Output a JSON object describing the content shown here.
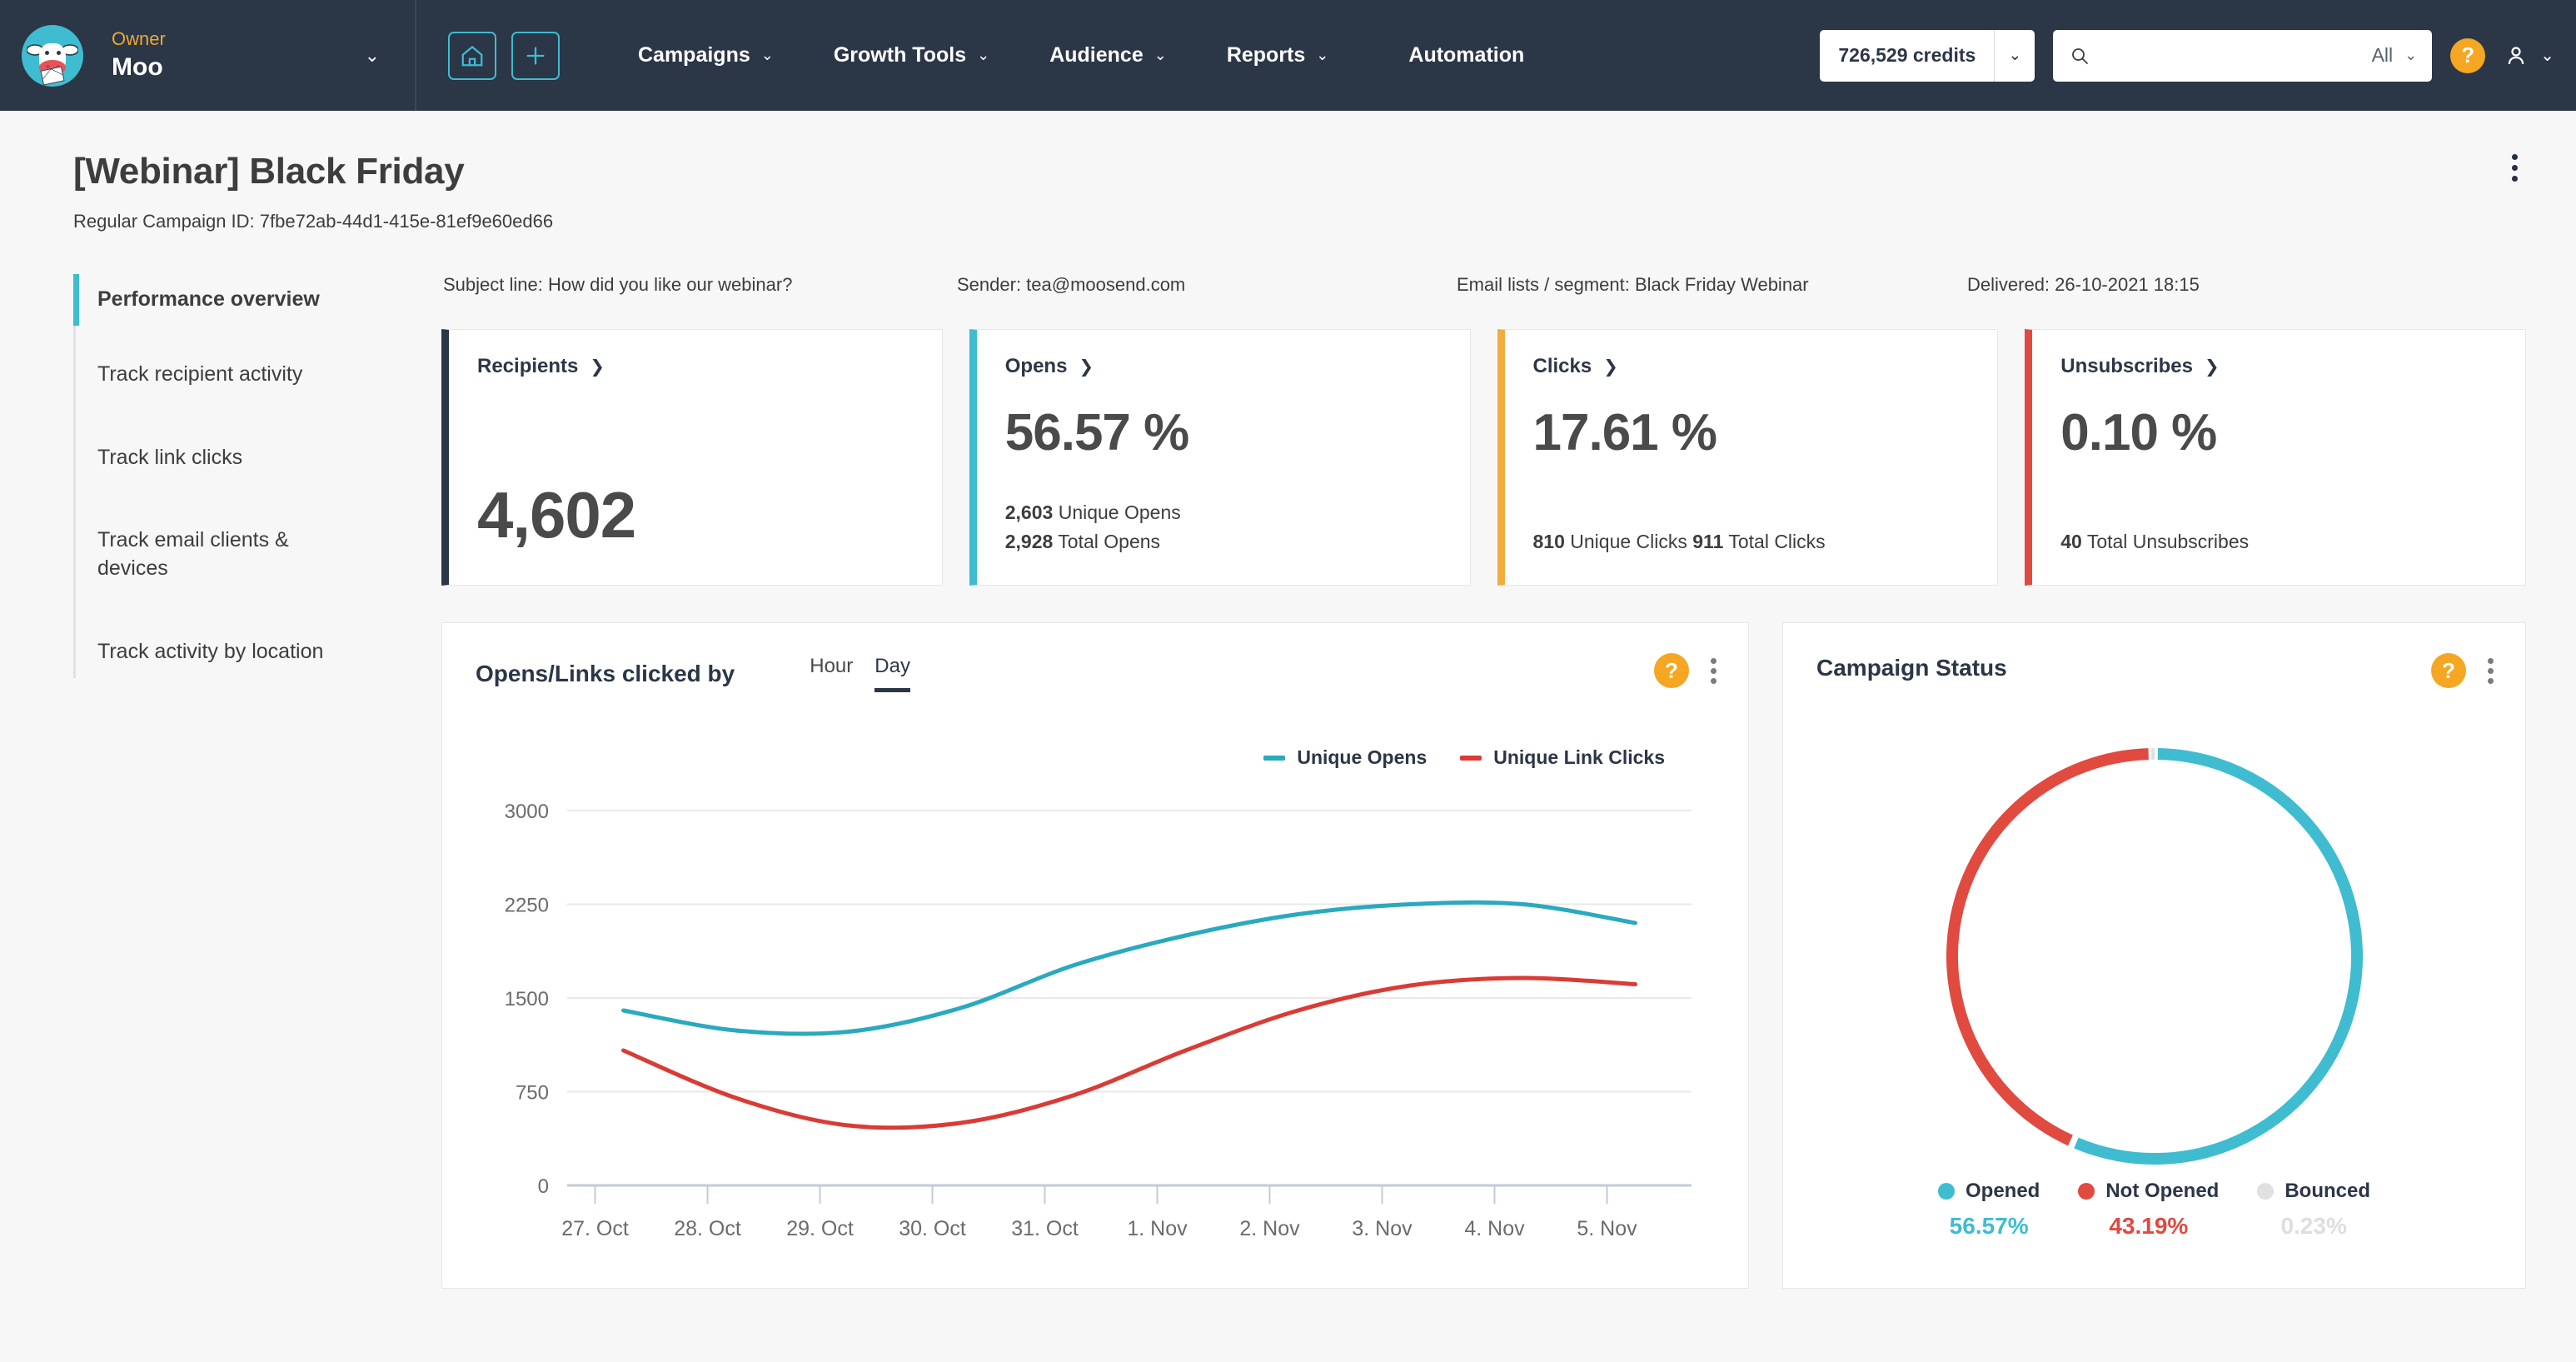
{
  "topnav": {
    "role_label": "Owner",
    "account_name": "Moo",
    "home_icon": "home-icon",
    "add_icon": "plus-icon",
    "links": [
      {
        "label": "Campaigns",
        "caret": true
      },
      {
        "label": "Growth Tools",
        "caret": true
      },
      {
        "label": "Audience",
        "caret": true
      },
      {
        "label": "Reports",
        "caret": true
      },
      {
        "label": "Automation",
        "caret": false
      }
    ],
    "credits": "726,529 credits",
    "search_placeholder": "",
    "search_value": "",
    "search_scope": "All",
    "help_label": "?",
    "colors": {
      "bar": "#2b3647",
      "accent": "#3fbcd0",
      "role": "#f0a830",
      "help": "#f5a623"
    }
  },
  "page": {
    "title": "[Webinar] Black Friday",
    "subtitle": "Regular Campaign ID: 7fbe72ab-44d1-415e-81ef9e60ed66"
  },
  "sidebar": {
    "items": [
      {
        "label": "Performance overview",
        "active": true
      },
      {
        "label": "Track recipient activity",
        "active": false
      },
      {
        "label": "Track link clicks",
        "active": false
      },
      {
        "label": "Track email clients & devices",
        "active": false
      },
      {
        "label": "Track activity by location",
        "active": false
      }
    ]
  },
  "meta": {
    "subject_line": "Subject line: How did you like our webinar?",
    "sender": "Sender: tea@moosend.com",
    "email_lists": "Email lists / segment: Black Friday Webinar",
    "delivered": "Delivered: 26-10-2021 18:15"
  },
  "cards": [
    {
      "title": "Recipients",
      "value": "4,602",
      "accent": "#2b3647",
      "sub_lines": []
    },
    {
      "title": "Opens",
      "value": "56.57 %",
      "accent": "#3fbcd0",
      "sub_lines": [
        {
          "num": "2,603",
          "text": " Unique Opens"
        },
        {
          "num": "2,928",
          "text": " Total Opens"
        }
      ]
    },
    {
      "title": "Clicks",
      "value": "17.61 %",
      "accent": "#f0ad3e",
      "sub_lines": [
        {
          "num": "810",
          "text": " Unique Clicks  ",
          "num2": "911",
          "text2": " Total Clicks"
        }
      ]
    },
    {
      "title": "Unsubscribes",
      "value": "0.10 %",
      "accent": "#e04a3f",
      "sub_lines": [
        {
          "num": "40",
          "text": " Total Unsubscribes"
        }
      ]
    }
  ],
  "opens_panel": {
    "title": "Opens/Links clicked by",
    "tabs": [
      {
        "label": "Hour",
        "active": false
      },
      {
        "label": "Day",
        "active": true
      }
    ],
    "help_label": "?"
  },
  "status_panel": {
    "title": "Campaign Status",
    "help_label": "?",
    "legend": [
      {
        "label": "Opened",
        "value": "56.57%",
        "color": "#3fbcd0"
      },
      {
        "label": "Not Opened",
        "value": "43.19%",
        "color": "#e04a3f"
      },
      {
        "label": "Bounced",
        "value": "0.23%",
        "color": "#e0e0e0"
      }
    ]
  },
  "chart_data": [
    {
      "type": "line",
      "title": "Opens/Links clicked by Day",
      "xlabel": "",
      "ylabel": "",
      "grid": true,
      "legend_position": "top-right",
      "categories": [
        "27. Oct",
        "28. Oct",
        "29. Oct",
        "30. Oct",
        "31. Oct",
        "1. Nov",
        "2. Nov",
        "3. Nov",
        "4. Nov",
        "5. Nov"
      ],
      "yticks": [
        0,
        750,
        1500,
        2250,
        3000
      ],
      "ylim": [
        0,
        3000
      ],
      "series": [
        {
          "name": "Unique Opens",
          "color": "#2aa9bf",
          "values": [
            1400,
            1240,
            1230,
            1420,
            1760,
            2000,
            2170,
            2250,
            2250,
            2100
          ]
        },
        {
          "name": "Unique Link Clicks",
          "color": "#d93b35",
          "values": [
            1080,
            700,
            480,
            500,
            720,
            1080,
            1400,
            1600,
            1660,
            1610
          ]
        }
      ]
    },
    {
      "type": "pie",
      "title": "Campaign Status",
      "labels": [
        "Opened",
        "Not Opened",
        "Bounced"
      ],
      "values": [
        56.57,
        43.19,
        0.23
      ],
      "colors": [
        "#3fbcd0",
        "#e04a3f",
        "#e0e0e0"
      ],
      "donut": true
    }
  ]
}
